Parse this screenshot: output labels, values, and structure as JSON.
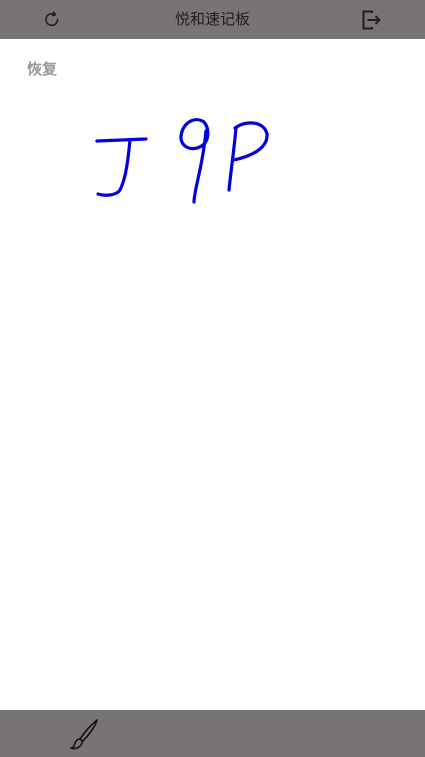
{
  "header": {
    "title": "悦和速记板",
    "left_icon": "refresh-icon",
    "right_icon": "exit-icon"
  },
  "toolbar": {
    "restore_label": "恢复"
  },
  "canvas": {
    "handwriting_text": "J9P",
    "ink_color": "#0000e0"
  },
  "footer": {
    "tool_icon": "brush-icon"
  },
  "colors": {
    "bar": "#787473",
    "restore_text": "#9a9a9a"
  }
}
